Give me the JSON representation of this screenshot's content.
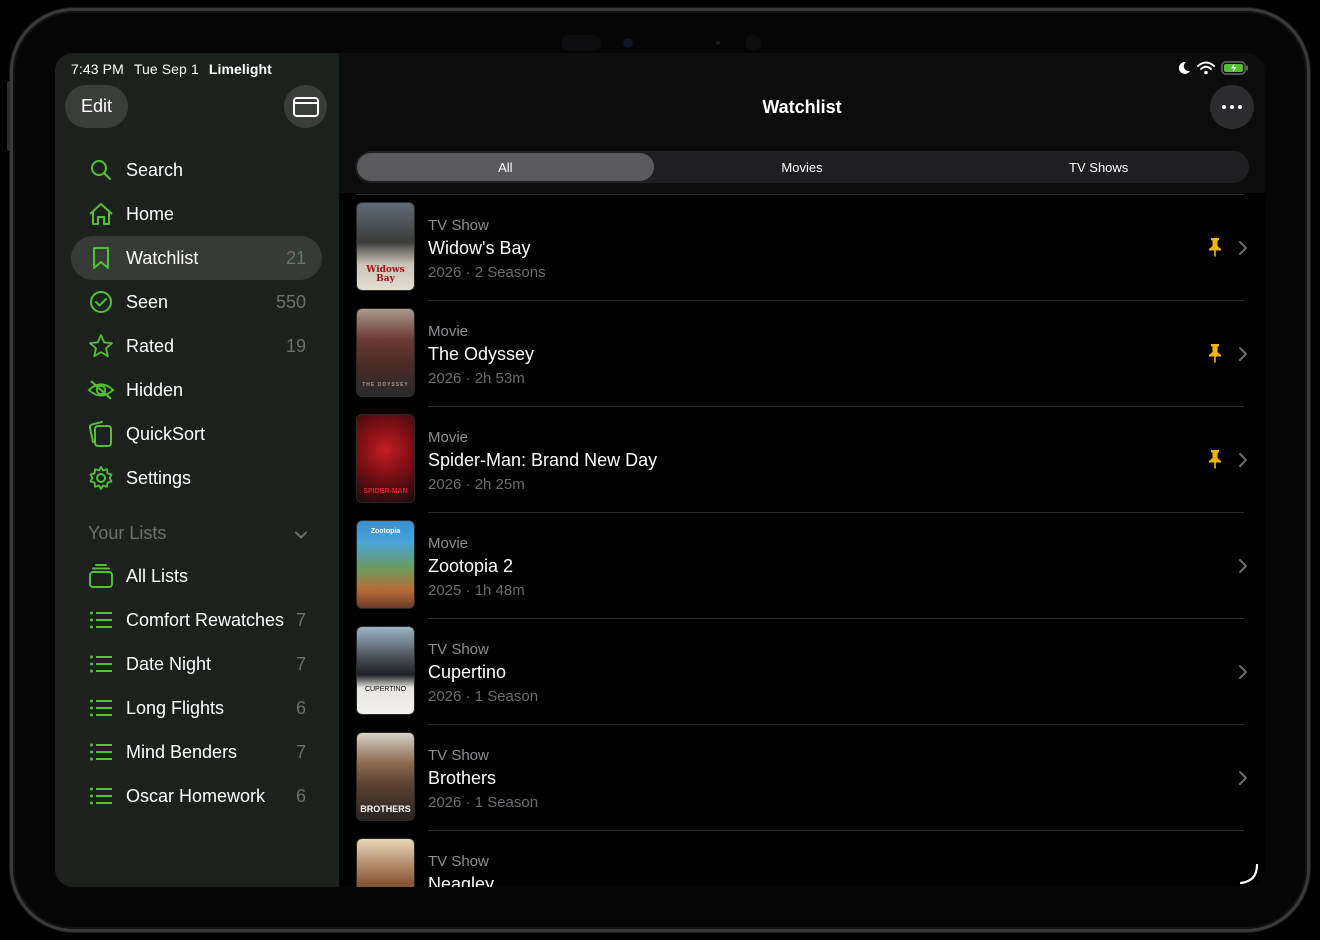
{
  "status": {
    "time": "7:43 PM",
    "date": "Tue Sep 1",
    "app": "Limelight"
  },
  "sidebar": {
    "edit_label": "Edit",
    "items": [
      {
        "label": "Search",
        "count": "",
        "icon": "search-icon"
      },
      {
        "label": "Home",
        "count": "",
        "icon": "home-icon"
      },
      {
        "label": "Watchlist",
        "count": "21",
        "icon": "bookmark-icon",
        "active": true
      },
      {
        "label": "Seen",
        "count": "550",
        "icon": "checkmark-circle-icon"
      },
      {
        "label": "Rated",
        "count": "19",
        "icon": "star-icon"
      },
      {
        "label": "Hidden",
        "count": "",
        "icon": "eye-slash-icon"
      },
      {
        "label": "QuickSort",
        "count": "",
        "icon": "cards-icon"
      },
      {
        "label": "Settings",
        "count": "",
        "icon": "gear-icon"
      }
    ],
    "lists_header": "Your Lists",
    "lists": [
      {
        "label": "All Lists",
        "count": "",
        "icon": "stack-icon"
      },
      {
        "label": "Comfort Rewatches",
        "count": "7",
        "icon": "list-icon"
      },
      {
        "label": "Date Night",
        "count": "7",
        "icon": "list-icon"
      },
      {
        "label": "Long Flights",
        "count": "6",
        "icon": "list-icon"
      },
      {
        "label": "Mind Benders",
        "count": "7",
        "icon": "list-icon"
      },
      {
        "label": "Oscar Homework",
        "count": "6",
        "icon": "list-icon"
      }
    ]
  },
  "main": {
    "title": "Watchlist",
    "segments": [
      "All",
      "Movies",
      "TV Shows"
    ],
    "selected_segment": "All",
    "items": [
      {
        "kind": "TV Show",
        "title": "Widow's Bay",
        "meta": "2026 · 2 Seasons",
        "pinned": true,
        "poster_text": "Widows Bay"
      },
      {
        "kind": "Movie",
        "title": "The Odyssey",
        "meta": "2026 · 2h 53m",
        "pinned": true,
        "poster_text": "THE ODYSSEY"
      },
      {
        "kind": "Movie",
        "title": "Spider-Man: Brand New Day",
        "meta": "2026 · 2h 25m",
        "pinned": true,
        "poster_text": "SPIDER-MAN"
      },
      {
        "kind": "Movie",
        "title": "Zootopia 2",
        "meta": "2025 · 1h 48m",
        "pinned": false,
        "poster_text": "Zootopia"
      },
      {
        "kind": "TV Show",
        "title": "Cupertino",
        "meta": "2026 · 1 Season",
        "pinned": false,
        "poster_text": "CUPERTINO"
      },
      {
        "kind": "TV Show",
        "title": "Brothers",
        "meta": "2026 · 1 Season",
        "pinned": false,
        "poster_text": "BROTHERS"
      },
      {
        "kind": "TV Show",
        "title": "Neagley",
        "meta": "",
        "pinned": false,
        "poster_text": ""
      }
    ]
  },
  "colors": {
    "accent": "#52c234",
    "pin": "#f5b400",
    "sidebar_bg": "#1d211d",
    "active_bg": "#363b36"
  }
}
